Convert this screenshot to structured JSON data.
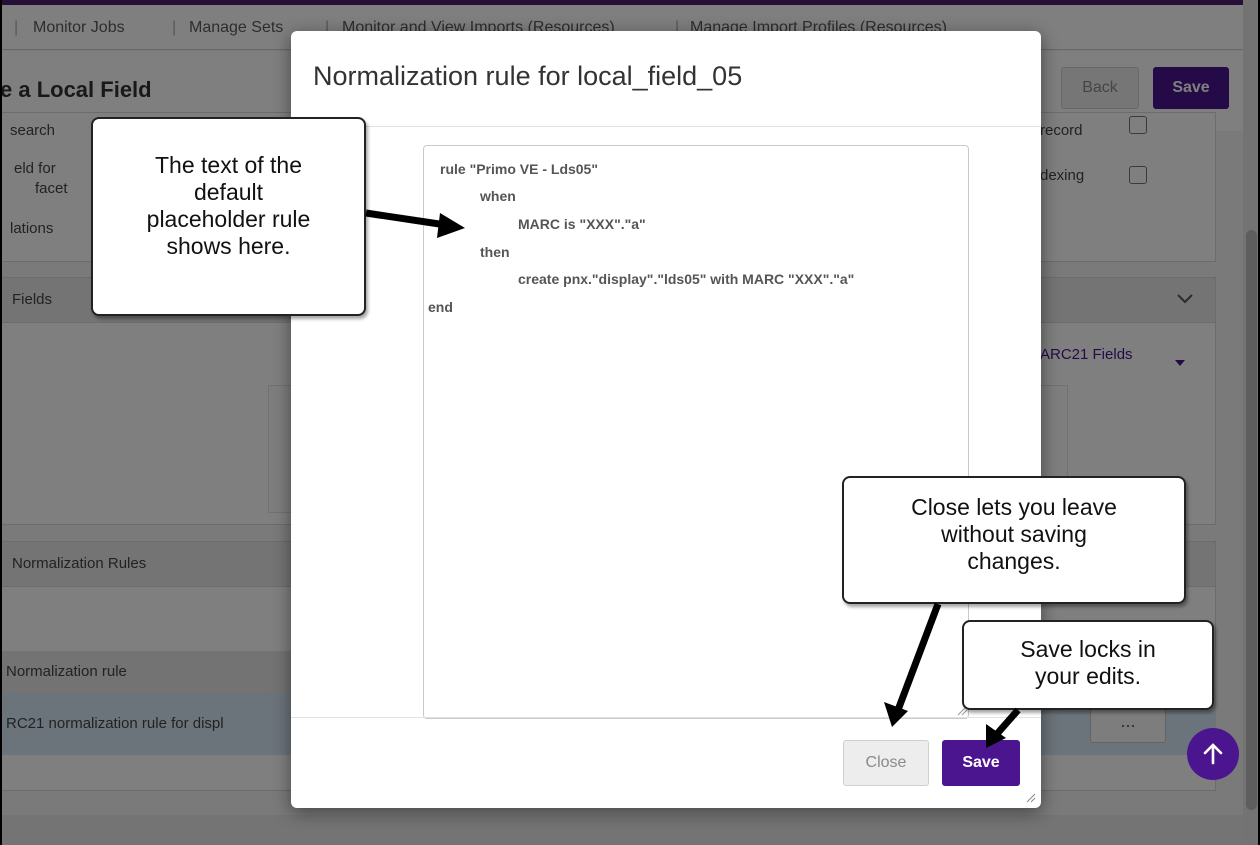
{
  "nav": {
    "items": [
      "Monitor Jobs",
      "Manage Sets",
      "Monitor and View Imports (Resources)",
      "Manage Import Profiles (Resources)"
    ]
  },
  "page": {
    "title_fragment": "e a Local Field",
    "back_label": "Back",
    "save_label": "Save"
  },
  "background": {
    "left_labels": [
      "search",
      "eld for",
      "facet",
      "lations"
    ],
    "right_labels": [
      "record",
      "dexing"
    ],
    "fields_section": "Fields",
    "marc21_fields": "ARC21 Fields",
    "normalization_section": "Normalization Rules",
    "table_header": "Normalization rule",
    "table_row": "RC21 normalization rule for displ",
    "dots_label": "..."
  },
  "modal": {
    "title": "Normalization rule for local_field_05",
    "rule_lines": [
      "rule \"Primo VE - Lds05\"",
      "when",
      "MARC is \"XXX\".\"a\"",
      "then",
      "create pnx.\"display\".\"lds05\" with MARC \"XXX\".\"a\"",
      "end"
    ],
    "close_label": "Close",
    "save_label": "Save"
  },
  "callouts": {
    "rule_text": [
      "The text of the",
      "default",
      "placeholder rule",
      "shows here."
    ],
    "close": [
      "Close lets you leave",
      "without saving",
      "changes."
    ],
    "save": [
      "Save locks in",
      "your edits."
    ]
  },
  "icons": {
    "scroll_top": "arrow-up-icon",
    "chevron": "chevron-down-icon",
    "caret": "caret-down-icon"
  },
  "colors": {
    "primary": "#4b1590",
    "overlay": "rgba(0,0,0,0.5)",
    "selected_row": "#d8e9f6"
  }
}
